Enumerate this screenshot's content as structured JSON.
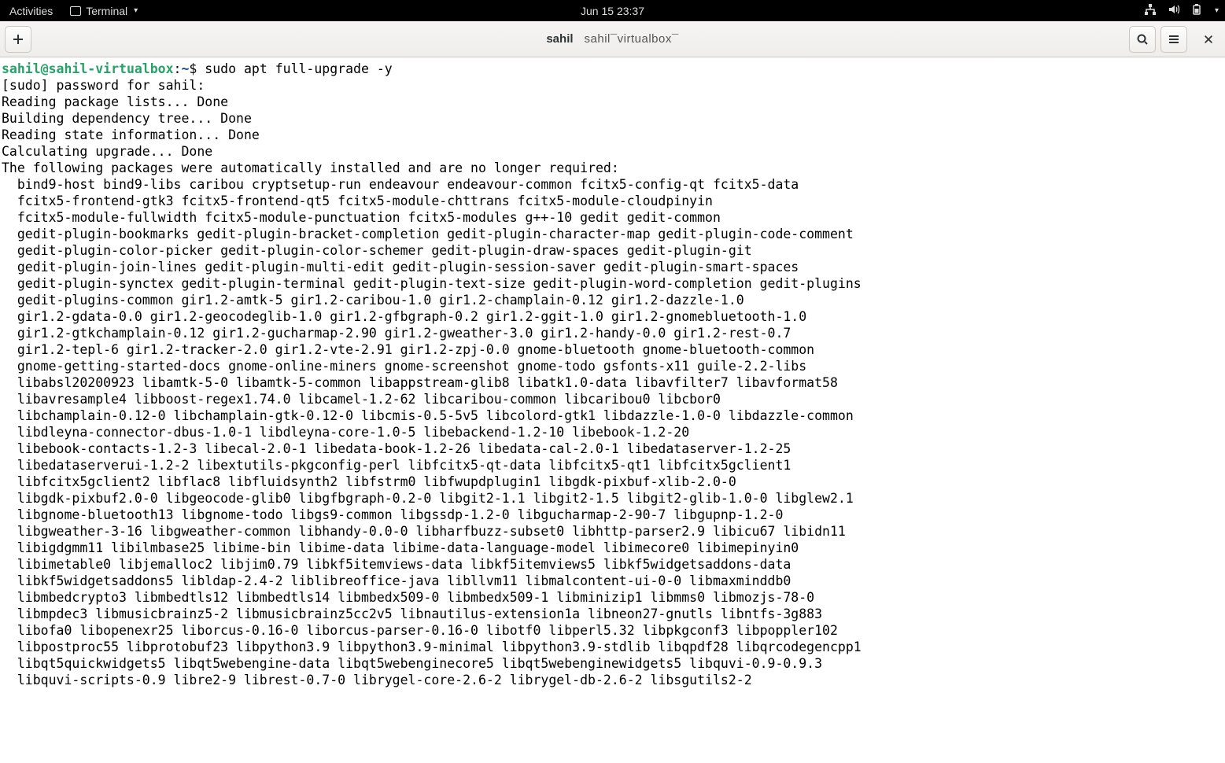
{
  "topbar": {
    "activities": "Activities",
    "app_name": "Terminal",
    "clock": "Jun 15  23:37"
  },
  "headerbar": {
    "title_main": "sahil",
    "title_sub": "sahil¯virtualbox¯"
  },
  "prompt": {
    "user_host": "sahil@sahil-virtualbox",
    "sep1": ":",
    "path": "~",
    "sep2": "$ ",
    "command": "sudo apt full-upgrade -y"
  },
  "preamble": [
    "[sudo] password for sahil:",
    "Reading package lists... Done",
    "Building dependency tree... Done",
    "Reading state information... Done",
    "Calculating upgrade... Done",
    "The following packages were automatically installed and are no longer required:"
  ],
  "packages": [
    "bind9-host bind9-libs caribou cryptsetup-run endeavour endeavour-common fcitx5-config-qt fcitx5-data",
    "fcitx5-frontend-gtk3 fcitx5-frontend-qt5 fcitx5-module-chttrans fcitx5-module-cloudpinyin",
    "fcitx5-module-fullwidth fcitx5-module-punctuation fcitx5-modules g++-10 gedit gedit-common",
    "gedit-plugin-bookmarks gedit-plugin-bracket-completion gedit-plugin-character-map gedit-plugin-code-comment",
    "gedit-plugin-color-picker gedit-plugin-color-schemer gedit-plugin-draw-spaces gedit-plugin-git",
    "gedit-plugin-join-lines gedit-plugin-multi-edit gedit-plugin-session-saver gedit-plugin-smart-spaces",
    "gedit-plugin-synctex gedit-plugin-terminal gedit-plugin-text-size gedit-plugin-word-completion gedit-plugins",
    "gedit-plugins-common gir1.2-amtk-5 gir1.2-caribou-1.0 gir1.2-champlain-0.12 gir1.2-dazzle-1.0",
    "gir1.2-gdata-0.0 gir1.2-geocodeglib-1.0 gir1.2-gfbgraph-0.2 gir1.2-ggit-1.0 gir1.2-gnomebluetooth-1.0",
    "gir1.2-gtkchamplain-0.12 gir1.2-gucharmap-2.90 gir1.2-gweather-3.0 gir1.2-handy-0.0 gir1.2-rest-0.7",
    "gir1.2-tepl-6 gir1.2-tracker-2.0 gir1.2-vte-2.91 gir1.2-zpj-0.0 gnome-bluetooth gnome-bluetooth-common",
    "gnome-getting-started-docs gnome-online-miners gnome-screenshot gnome-todo gsfonts-x11 guile-2.2-libs",
    "libabsl20200923 libamtk-5-0 libamtk-5-common libappstream-glib8 libatk1.0-data libavfilter7 libavformat58",
    "libavresample4 libboost-regex1.74.0 libcamel-1.2-62 libcaribou-common libcaribou0 libcbor0",
    "libchamplain-0.12-0 libchamplain-gtk-0.12-0 libcmis-0.5-5v5 libcolord-gtk1 libdazzle-1.0-0 libdazzle-common",
    "libdleyna-connector-dbus-1.0-1 libdleyna-core-1.0-5 libebackend-1.2-10 libebook-1.2-20",
    "libebook-contacts-1.2-3 libecal-2.0-1 libedata-book-1.2-26 libedata-cal-2.0-1 libedataserver-1.2-25",
    "libedataserverui-1.2-2 libextutils-pkgconfig-perl libfcitx5-qt-data libfcitx5-qt1 libfcitx5gclient1",
    "libfcitx5gclient2 libflac8 libfluidsynth2 libfstrm0 libfwupdplugin1 libgdk-pixbuf-xlib-2.0-0",
    "libgdk-pixbuf2.0-0 libgeocode-glib0 libgfbgraph-0.2-0 libgit2-1.1 libgit2-1.5 libgit2-glib-1.0-0 libglew2.1",
    "libgnome-bluetooth13 libgnome-todo libgs9-common libgssdp-1.2-0 libgucharmap-2-90-7 libgupnp-1.2-0",
    "libgweather-3-16 libgweather-common libhandy-0.0-0 libharfbuzz-subset0 libhttp-parser2.9 libicu67 libidn11",
    "libigdgmm11 libilmbase25 libime-bin libime-data libime-data-language-model libimecore0 libimepinyin0",
    "libimetable0 libjemalloc2 libjim0.79 libkf5itemviews-data libkf5itemviews5 libkf5widgetsaddons-data",
    "libkf5widgetsaddons5 libldap-2.4-2 liblibreoffice-java libllvm11 libmalcontent-ui-0-0 libmaxminddb0",
    "libmbedcrypto3 libmbedtls12 libmbedtls14 libmbedx509-0 libmbedx509-1 libminizip1 libmms0 libmozjs-78-0",
    "libmpdec3 libmusicbrainz5-2 libmusicbrainz5cc2v5 libnautilus-extension1a libneon27-gnutls libntfs-3g883",
    "libofa0 libopenexr25 liborcus-0.16-0 liborcus-parser-0.16-0 libotf0 libperl5.32 libpkgconf3 libpoppler102",
    "libpostproc55 libprotobuf23 libpython3.9 libpython3.9-minimal libpython3.9-stdlib libqpdf28 libqrcodegencpp1",
    "libqt5quickwidgets5 libqt5webengine-data libqt5webenginecore5 libqt5webenginewidgets5 libquvi-0.9-0.9.3",
    "libquvi-scripts-0.9 libre2-9 librest-0.7-0 librygel-core-2.6-2 librygel-db-2.6-2 libsgutils2-2"
  ]
}
